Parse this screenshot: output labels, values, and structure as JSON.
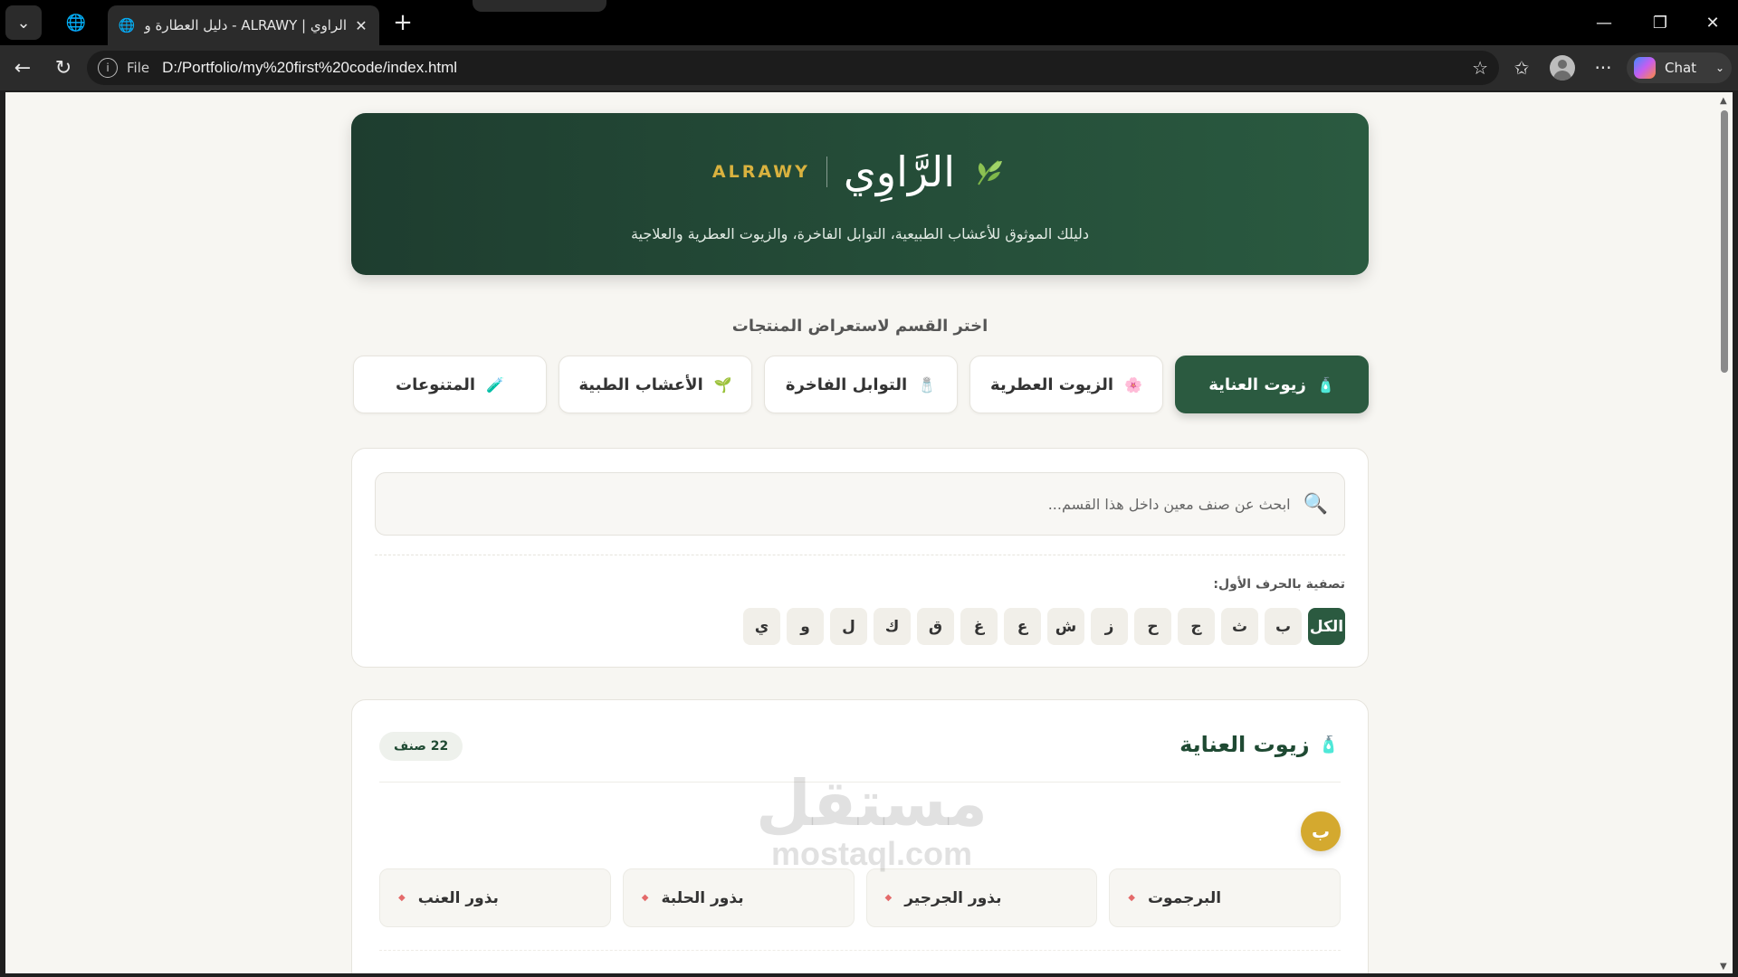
{
  "browser": {
    "tab_title": "الراوي | ALRAWY - دليل العطارة والز",
    "url_scheme": "File",
    "url": "D:/Portfolio/my%20first%20code/index.html",
    "chat_label": "Chat"
  },
  "hero": {
    "brand_latin": "ALRAWY",
    "brand_arabic": "الرَّاوِي",
    "subtitle": "دليلك الموثوق للأعشاب الطبيعية، التوابل الفاخرة، والزيوت العطرية والعلاجية"
  },
  "section_title": "اختر القسم لاستعراض المنتجات",
  "categories": [
    {
      "label": "زيوت العناية",
      "icon": "🧴",
      "active": true
    },
    {
      "label": "الزيوت العطرية",
      "icon": "🌸",
      "active": false
    },
    {
      "label": "التوابل الفاخرة",
      "icon": "🧂",
      "active": false
    },
    {
      "label": "الأعشاب الطبية",
      "icon": "🌱",
      "active": false
    },
    {
      "label": "المتنوعات",
      "icon": "🧪",
      "active": false
    }
  ],
  "search": {
    "placeholder": "ابحث عن صنف معين داخل هذا القسم..."
  },
  "letters_filter": {
    "label": "تصفية بالحرف الأول:",
    "letters": [
      "الكل",
      "ب",
      "ث",
      "ج",
      "ح",
      "ز",
      "ش",
      "ع",
      "غ",
      "ق",
      "ك",
      "ل",
      "و",
      "ي"
    ],
    "active": "الكل"
  },
  "list": {
    "title": "زيوت العناية",
    "count": "22 صنف",
    "group_letter": "ب",
    "items": [
      "البرجموت",
      "بذور الجرجير",
      "بذور الحلبة",
      "بذور العنب"
    ]
  },
  "watermark": {
    "arabic": "مستقل",
    "latin": "mostaql.com"
  },
  "colors": {
    "primary": "#2b5a40",
    "gold": "#d4a92f",
    "background": "#f7f6f2"
  }
}
